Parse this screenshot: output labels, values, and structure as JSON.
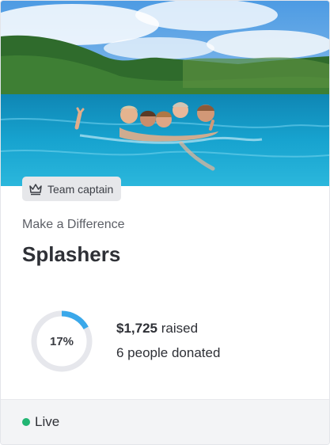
{
  "card": {
    "badge_label": "Team captain",
    "badge_icon": "crown-icon",
    "organization": "Make a Difference",
    "team_name": "Splashers",
    "progress": {
      "percent": 17,
      "label": "17%",
      "track_color": "#e6e7ec",
      "fill_color": "#3aa8ea"
    },
    "raised_amount": "$1,725",
    "raised_suffix": " raised",
    "donors_text": "6 people donated",
    "status": {
      "label": "Live",
      "color": "#22b573"
    },
    "hero_image": "group-of-swimmers-in-sea-photo"
  }
}
